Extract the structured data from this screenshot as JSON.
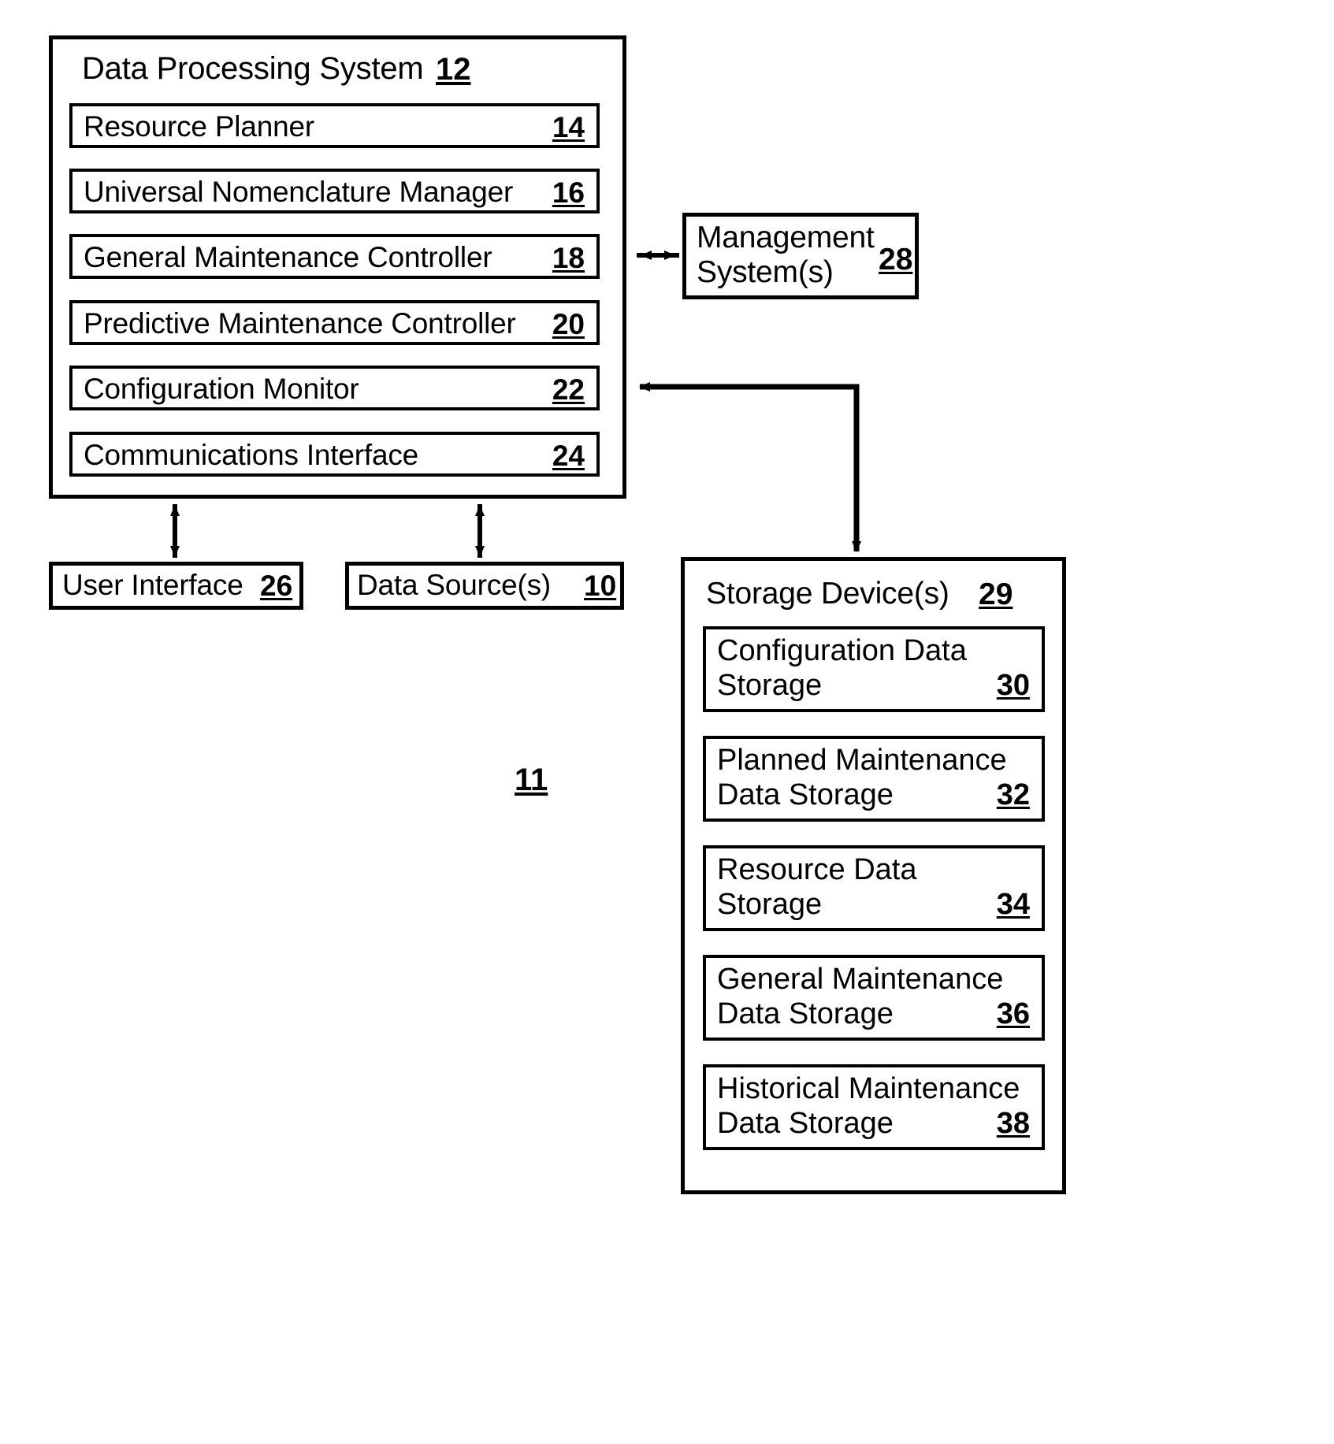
{
  "figure": {
    "number": "11"
  },
  "data_processing_system": {
    "title": "Data Processing System",
    "ref": "12",
    "modules": [
      {
        "label": "Resource Planner",
        "ref": "14"
      },
      {
        "label": "Universal Nomenclature Manager",
        "ref": "16"
      },
      {
        "label": "General Maintenance Controller",
        "ref": "18"
      },
      {
        "label": "Predictive Maintenance Controller",
        "ref": "20"
      },
      {
        "label": "Configuration Monitor",
        "ref": "22"
      },
      {
        "label": "Communications Interface",
        "ref": "24"
      }
    ]
  },
  "management_system": {
    "line1": "Management",
    "line2": "System(s)",
    "ref": "28"
  },
  "user_interface": {
    "label": "User Interface",
    "ref": "26"
  },
  "data_source": {
    "label": "Data Source(s)",
    "ref": "10"
  },
  "storage_device": {
    "title": "Storage Device(s)",
    "ref": "29",
    "items": [
      {
        "line1": "Configuration Data",
        "line2": "Storage",
        "ref": "30"
      },
      {
        "line1": "Planned Maintenance",
        "line2": "Data Storage",
        "ref": "32"
      },
      {
        "line1": "Resource Data",
        "line2": "Storage",
        "ref": "34"
      },
      {
        "line1": "General Maintenance",
        "line2": "Data Storage",
        "ref": "36"
      },
      {
        "line1": "Historical Maintenance",
        "line2": "Data Storage",
        "ref": "38"
      }
    ]
  },
  "colors": {
    "stroke": "#000000",
    "background": "#ffffff"
  }
}
